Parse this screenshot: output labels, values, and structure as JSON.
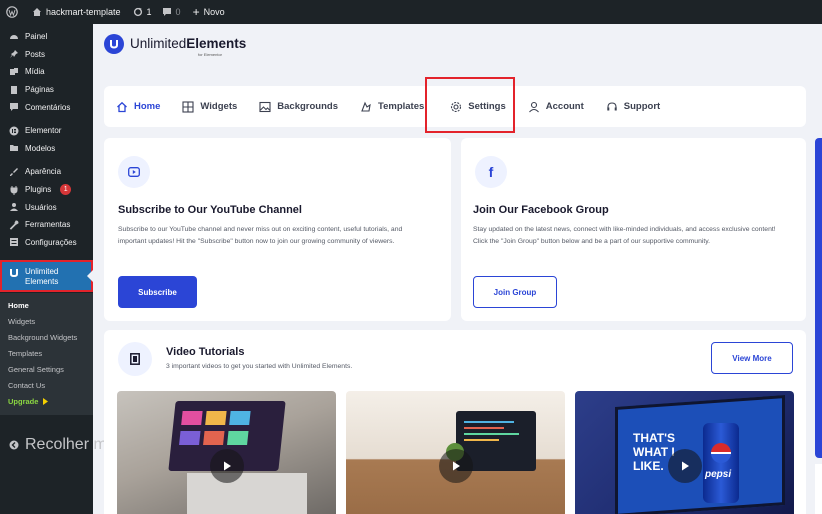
{
  "adminbar": {
    "site_name": "hackmart-template",
    "updates_count": "1",
    "comments_count": "0",
    "new_label": "Novo"
  },
  "sidebar": {
    "items": [
      {
        "label": "Painel",
        "icon": "dashboard-icon"
      },
      {
        "label": "Posts",
        "icon": "pin-icon"
      },
      {
        "label": "Mídia",
        "icon": "media-icon"
      },
      {
        "label": "Páginas",
        "icon": "pages-icon"
      },
      {
        "label": "Comentários",
        "icon": "comments-icon"
      },
      {
        "label": "Elementor",
        "icon": "elementor-icon"
      },
      {
        "label": "Modelos",
        "icon": "folder-icon"
      },
      {
        "label": "Aparência",
        "icon": "brush-icon"
      },
      {
        "label": "Plugins",
        "icon": "plugin-icon",
        "badge": "1"
      },
      {
        "label": "Usuários",
        "icon": "users-icon"
      },
      {
        "label": "Ferramentas",
        "icon": "wrench-icon"
      },
      {
        "label": "Configurações",
        "icon": "settings-icon"
      }
    ],
    "active_item": {
      "line1": "Unlimited",
      "line2": "Elements"
    },
    "submenu": [
      "Home",
      "Widgets",
      "Background Widgets",
      "Templates",
      "General Settings",
      "Contact Us"
    ],
    "upgrade_label": "Upgrade",
    "collapse_label": "Recolher menu"
  },
  "logo": {
    "brand_light": "Unlimited",
    "brand_bold": "Elements",
    "sub": "for Elementor"
  },
  "tabs": [
    {
      "label": "Home",
      "icon": "home-icon",
      "active": true
    },
    {
      "label": "Widgets",
      "icon": "grid-icon"
    },
    {
      "label": "Backgrounds",
      "icon": "image-icon"
    },
    {
      "label": "Templates",
      "icon": "templates-icon"
    },
    {
      "label": "Settings",
      "icon": "gear-icon"
    },
    {
      "label": "Account",
      "icon": "user-icon"
    },
    {
      "label": "Support",
      "icon": "headset-icon"
    }
  ],
  "youtube_card": {
    "title": "Subscribe to Our YouTube Channel",
    "body": "Subscribe to our YouTube channel and never miss out on exciting content, useful tutorials, and important updates! Hit the \"Subscribe\" button now to join our growing community of viewers.",
    "button": "Subscribe"
  },
  "facebook_card": {
    "title": "Join Our Facebook Group",
    "body": "Stay updated on the latest news, connect with like-minded individuals, and access exclusive content! Click the \"Join Group\" button below and be a part of our supportive community.",
    "button": "Join Group"
  },
  "videos": {
    "title": "Video Tutorials",
    "subtitle": "3 important videos to get you started with Unlimited Elements.",
    "button": "View More",
    "thumb3_text": [
      "THAT'S",
      "WHAT I",
      "LIKE."
    ],
    "thumb3_brand": "pepsi"
  },
  "colors": {
    "brand_blue": "#2b45d6",
    "wp_dark": "#1d2327",
    "wp_active": "#2271b1",
    "highlight_red": "#e3232b",
    "upgrade_green": "#8bd642"
  }
}
